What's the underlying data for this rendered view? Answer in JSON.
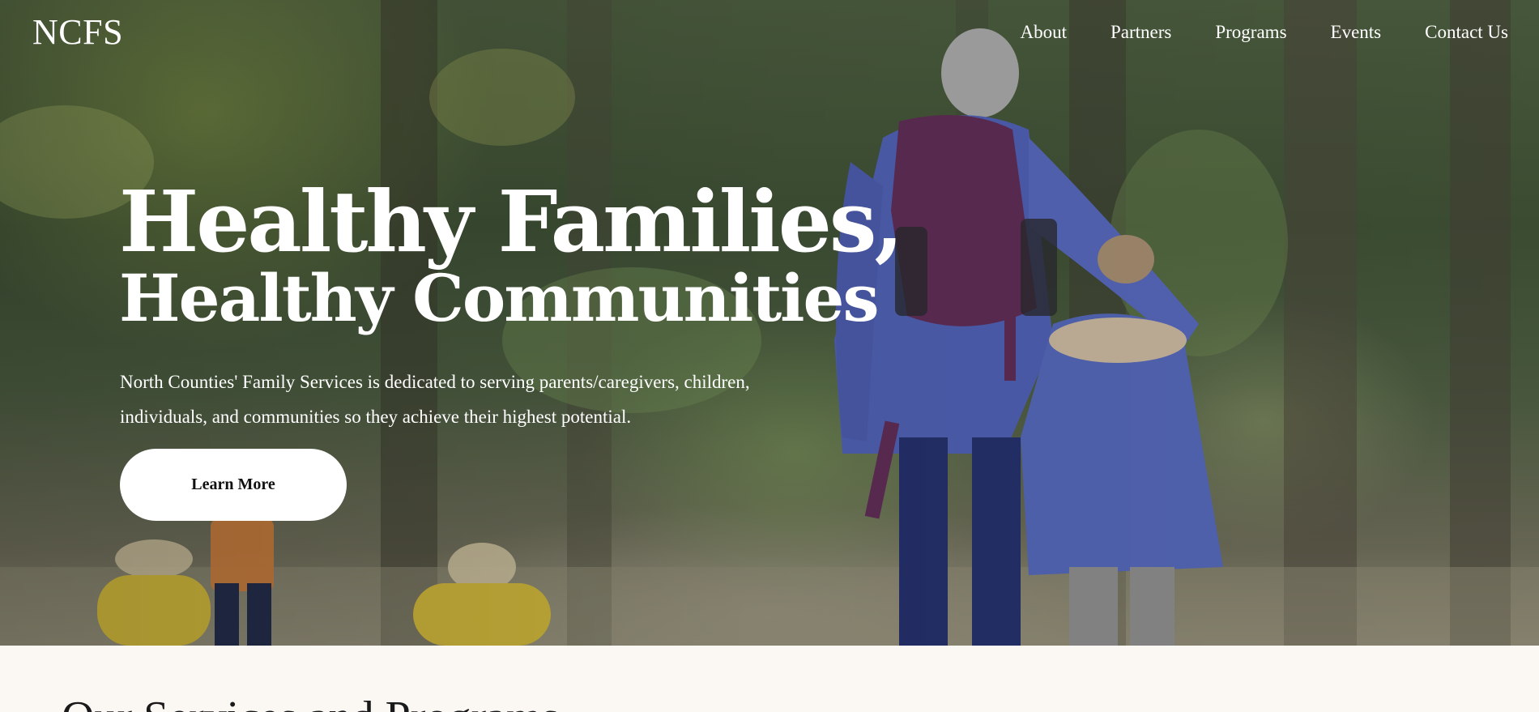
{
  "header": {
    "logo": "NCFS",
    "nav": {
      "about": "About",
      "partners": "Partners",
      "programs": "Programs",
      "events": "Events",
      "contact": "Contact Us"
    }
  },
  "hero": {
    "headline_line1": "Healthy Families,",
    "headline_line2": "Healthy Communities",
    "intro": "North Counties' Family Services is dedicated to serving parents/caregivers, children, individuals, and communities so they achieve their highest potential.",
    "cta_label": "Learn More"
  },
  "services": {
    "title": "Our Services and Programs"
  },
  "colors": {
    "hero_text": "#ffffff",
    "button_bg": "#ffffff",
    "page_bg": "#fbf7f3"
  }
}
